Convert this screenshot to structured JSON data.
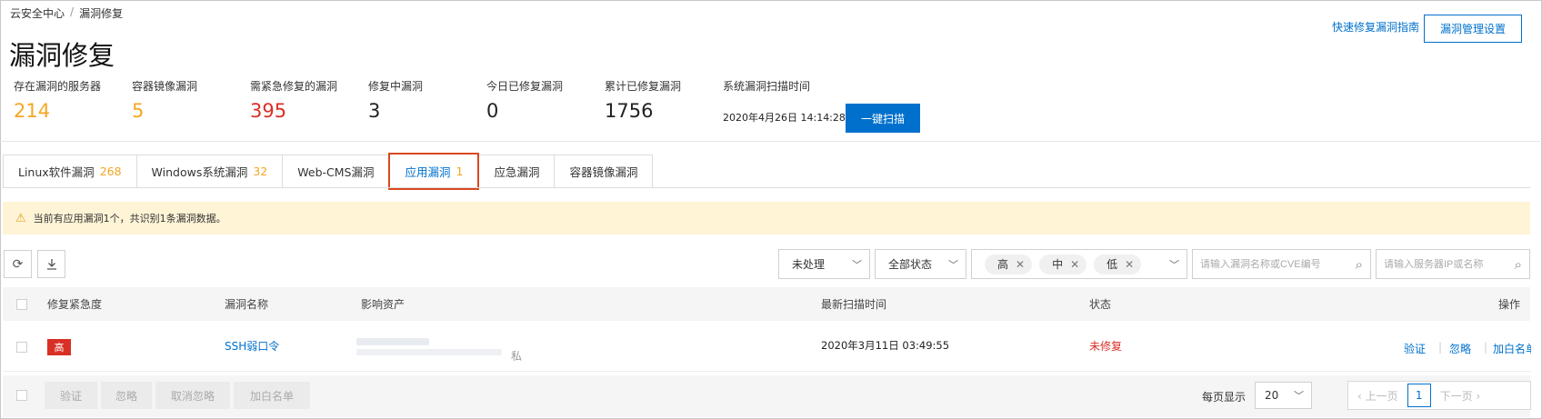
{
  "breadcrumb": {
    "root": "云安全中心",
    "sep": "/",
    "current": "漏洞修复"
  },
  "page_title": "漏洞修复",
  "header_links": {
    "guide": "快速修复漏洞指南",
    "settings": "漏洞管理设置"
  },
  "stats": [
    {
      "label": "存在漏洞的服务器",
      "value": "214"
    },
    {
      "label": "容器镜像漏洞",
      "value": "5"
    },
    {
      "label": "需紧急修复的漏洞",
      "value": "395"
    },
    {
      "label": "修复中漏洞",
      "value": "3"
    },
    {
      "label": "今日已修复漏洞",
      "value": "0"
    },
    {
      "label": "累计已修复漏洞",
      "value": "1756"
    },
    {
      "label": "系统漏洞扫描时间",
      "value": ""
    }
  ],
  "scan_time": "2020年4月26日 14:14:28",
  "scan_button": "一键扫描",
  "tabs": [
    {
      "label": "Linux软件漏洞",
      "count": "268"
    },
    {
      "label": "Windows系统漏洞",
      "count": "32"
    },
    {
      "label": "Web-CMS漏洞",
      "count": ""
    },
    {
      "label": "应用漏洞",
      "count": "1",
      "active": true
    },
    {
      "label": "应急漏洞",
      "count": ""
    },
    {
      "label": "容器镜像漏洞",
      "count": ""
    }
  ],
  "notice": "当前有应用漏洞1个，共识别1条漏洞数据。",
  "filters": {
    "process": "未处理",
    "status": "全部状态",
    "levels": [
      "高",
      "中",
      "低"
    ],
    "search_vuln_placeholder": "请输入漏洞名称或CVE编号",
    "search_server_placeholder": "请输入服务器IP或名称"
  },
  "table": {
    "headers": [
      "修复紧急度",
      "漏洞名称",
      "影响资产",
      "最新扫描时间",
      "状态",
      "操作"
    ],
    "rows": [
      {
        "severity": "高",
        "name": "SSH弱口令",
        "asset_suffix": "私",
        "scan_time": "2020年3月11日 03:49:55",
        "status": "未修复",
        "actions": [
          "验证",
          "忽略",
          "加白名单"
        ]
      }
    ]
  },
  "footer": {
    "batch_buttons": [
      "验证",
      "忽略",
      "取消忽略",
      "加白名单"
    ],
    "page_size_label": "每页显示",
    "page_size": "20",
    "prev": "上一页",
    "current_page": "1",
    "next": "下一页"
  },
  "colors": {
    "accent": "#0070cc",
    "warning": "#f5a623",
    "danger": "#d93026",
    "highlight": "#d9481f"
  }
}
